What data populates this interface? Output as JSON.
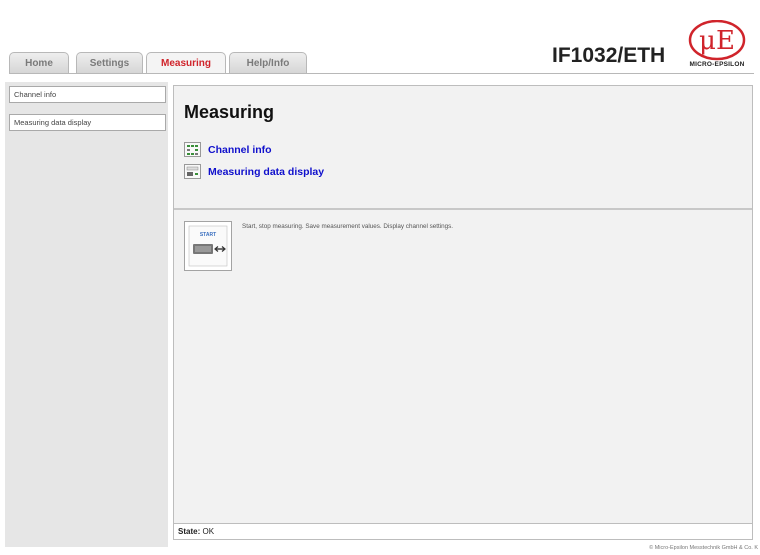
{
  "header": {
    "tabs": [
      {
        "label": "Home"
      },
      {
        "label": "Settings"
      },
      {
        "label": "Measuring",
        "active": true
      },
      {
        "label": "Help/Info"
      }
    ],
    "device_title": "IF1032/ETH",
    "logo_text": "MICRO-EPSILON",
    "logo_mark": "μE"
  },
  "sidebar": {
    "items": [
      {
        "label": "Channel info"
      },
      {
        "label": "Measuring data display"
      }
    ]
  },
  "main": {
    "title": "Measuring",
    "links": [
      {
        "label": "Channel info",
        "icon": "channel-info-icon"
      },
      {
        "label": "Measuring data display",
        "icon": "measuring-data-icon"
      }
    ],
    "thumb_label": "START",
    "description": "Start, stop measuring. Save measurement values. Display channel settings.",
    "state_label": "State:",
    "state_value": "OK"
  },
  "footer": {
    "copyright": "© Micro-Epsilon Messtechnik GmbH & Co. K"
  },
  "colors": {
    "active_tab": "#d0242b",
    "link": "#1010cc",
    "logo_red": "#d0242b"
  }
}
